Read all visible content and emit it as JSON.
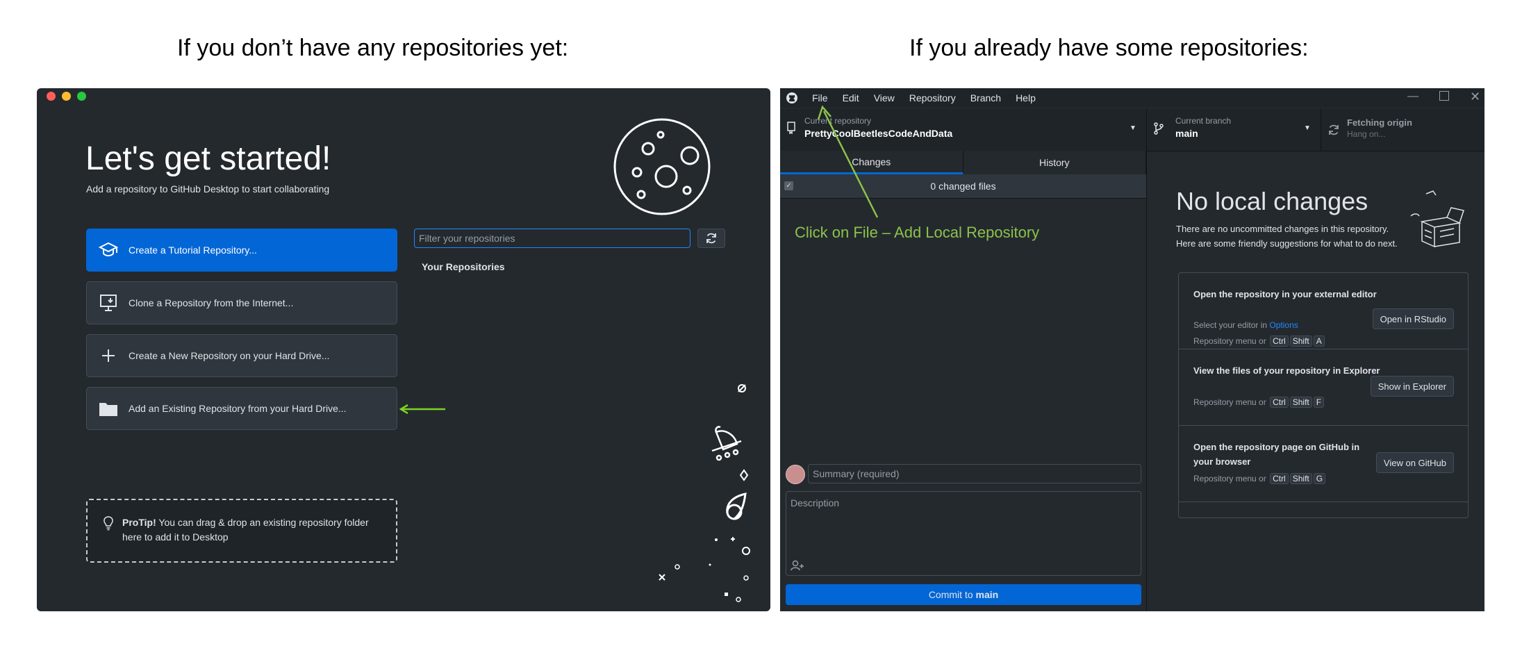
{
  "headings": {
    "left": "If you don’t have any repositories yet:",
    "right": "If you already have some repositories:"
  },
  "left_window": {
    "title": "Let's get started!",
    "subtitle": "Add a repository to GitHub Desktop to start collaborating",
    "options": [
      {
        "label": "Create a Tutorial Repository...",
        "icon": "mortarboard-icon"
      },
      {
        "label": "Clone a Repository from the Internet...",
        "icon": "desktop-download-icon"
      },
      {
        "label": "Create a New Repository on your Hard Drive...",
        "icon": "plus-icon"
      },
      {
        "label": "Add an Existing Repository from your Hard Drive...",
        "icon": "folder-icon"
      }
    ],
    "filter_placeholder": "Filter your repositories",
    "your_repositories": "Your Repositories",
    "protip_bold": "ProTip!",
    "protip_text": " You can drag & drop an existing repository folder here to add it to Desktop",
    "colors": {
      "primary": "#0366d6",
      "background": "#24292e",
      "arrow": "#7ed321"
    }
  },
  "right_window": {
    "menu": [
      "File",
      "Edit",
      "View",
      "Repository",
      "Branch",
      "Help"
    ],
    "current_repository_label": "Current repository",
    "current_repository_value": "PrettyCoolBeetlesCodeAndData",
    "current_branch_label": "Current branch",
    "current_branch_value": "main",
    "fetch_label": "Fetching origin",
    "fetch_sub": "Hang on...",
    "tabs": [
      "Changes",
      "History"
    ],
    "changed_files": "0 changed files",
    "summary_placeholder": "Summary (required)",
    "description_placeholder": "Description",
    "commit_prefix": "Commit to ",
    "commit_branch": "main",
    "no_changes_title": "No local changes",
    "no_changes_line1": "There are no uncommitted changes in this repository.",
    "no_changes_line2": "Here are some friendly suggestions for what to do next.",
    "suggestions": [
      {
        "title": "Open the repository in your external editor",
        "line_prefix": "Select your editor in ",
        "line_link": "Options",
        "menu_prefix": "Repository menu or",
        "keys": [
          "Ctrl",
          "Shift",
          "A"
        ],
        "button": "Open in RStudio"
      },
      {
        "title": "View the files of your repository in Explorer",
        "menu_prefix": "Repository menu or",
        "keys": [
          "Ctrl",
          "Shift",
          "F"
        ],
        "button": "Show in Explorer"
      },
      {
        "title": "Open the repository page on GitHub in your browser",
        "menu_prefix": "Repository menu or",
        "keys": [
          "Ctrl",
          "Shift",
          "G"
        ],
        "button": "View on GitHub"
      }
    ],
    "annotation": "Click on File – Add Local Repository",
    "colors": {
      "link": "#2188ff",
      "annotation": "#8bc34a"
    }
  }
}
